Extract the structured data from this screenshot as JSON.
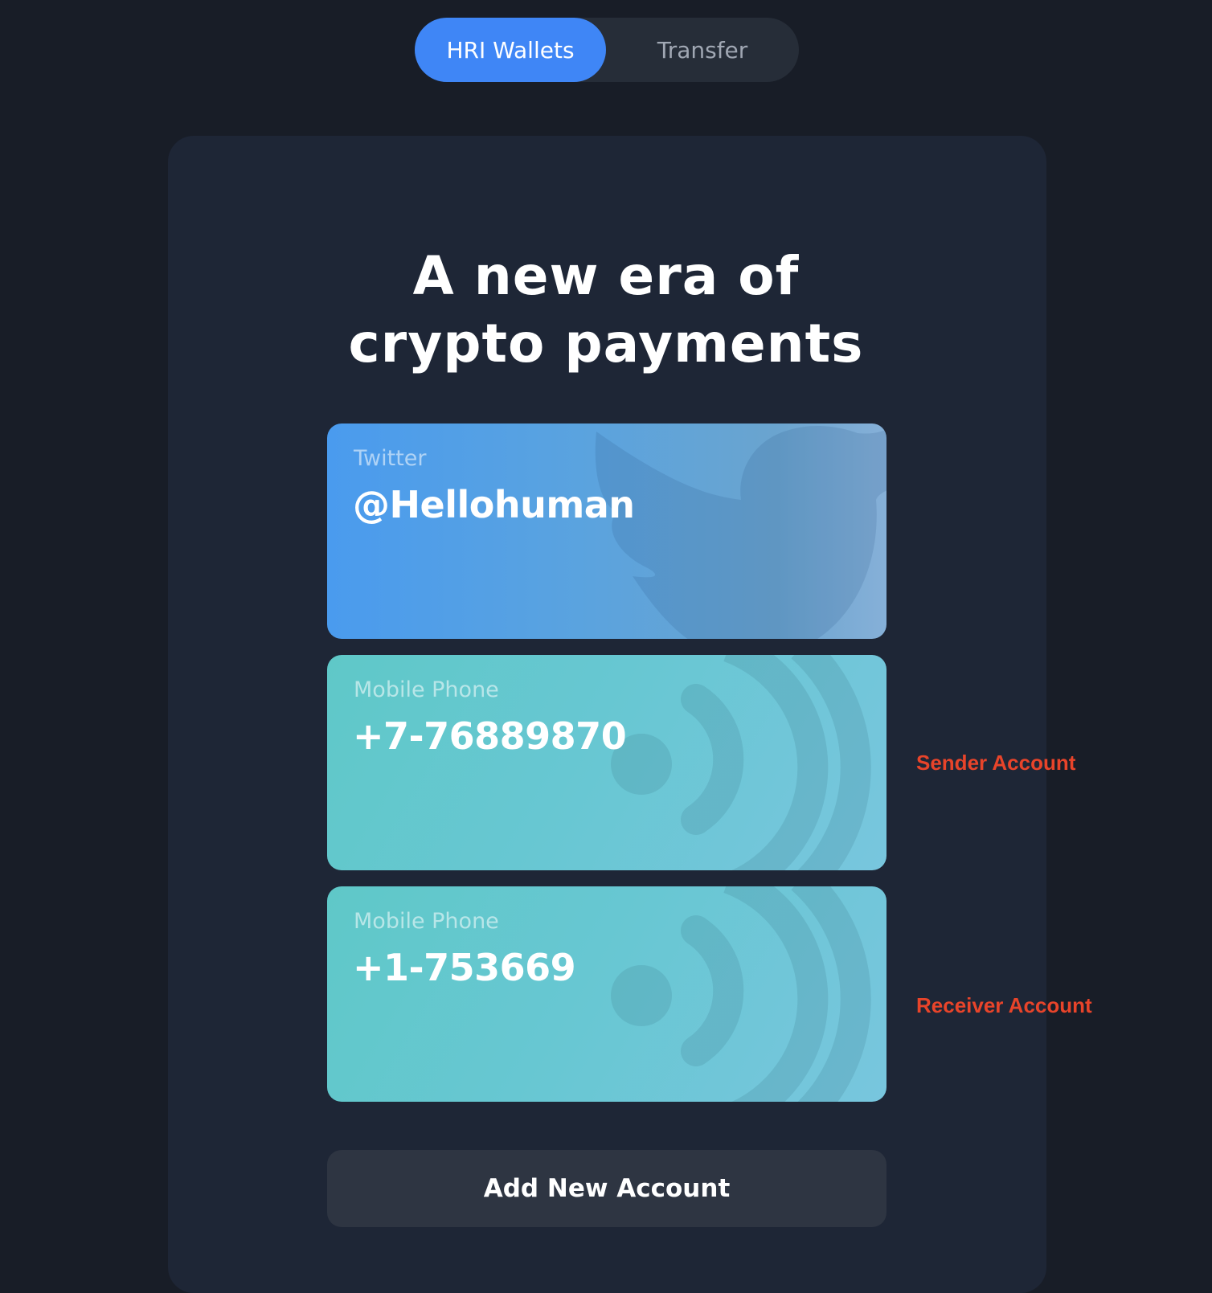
{
  "tabs": [
    {
      "label": "HRI Wallets",
      "active": true
    },
    {
      "label": "Transfer",
      "active": false
    }
  ],
  "hero": {
    "line1": "A new era of",
    "line2": "crypto payments"
  },
  "accounts": [
    {
      "type": "Twitter",
      "value": "@Hellohuman",
      "icon": "twitter-bird-icon"
    },
    {
      "type": "Mobile Phone",
      "value": "+7-76889870",
      "icon": "signal-waves-icon"
    },
    {
      "type": "Mobile Phone",
      "value": "+1-753669",
      "icon": "signal-waves-icon"
    }
  ],
  "annotations": {
    "sender": "Sender Account",
    "receiver": "Receiver Account"
  },
  "add_button": {
    "label": "Add New Account"
  },
  "colors": {
    "background": "#181d27",
    "panel": "#1e2636",
    "tab_active": "#3f86f6",
    "annotation": "#e8442a"
  }
}
